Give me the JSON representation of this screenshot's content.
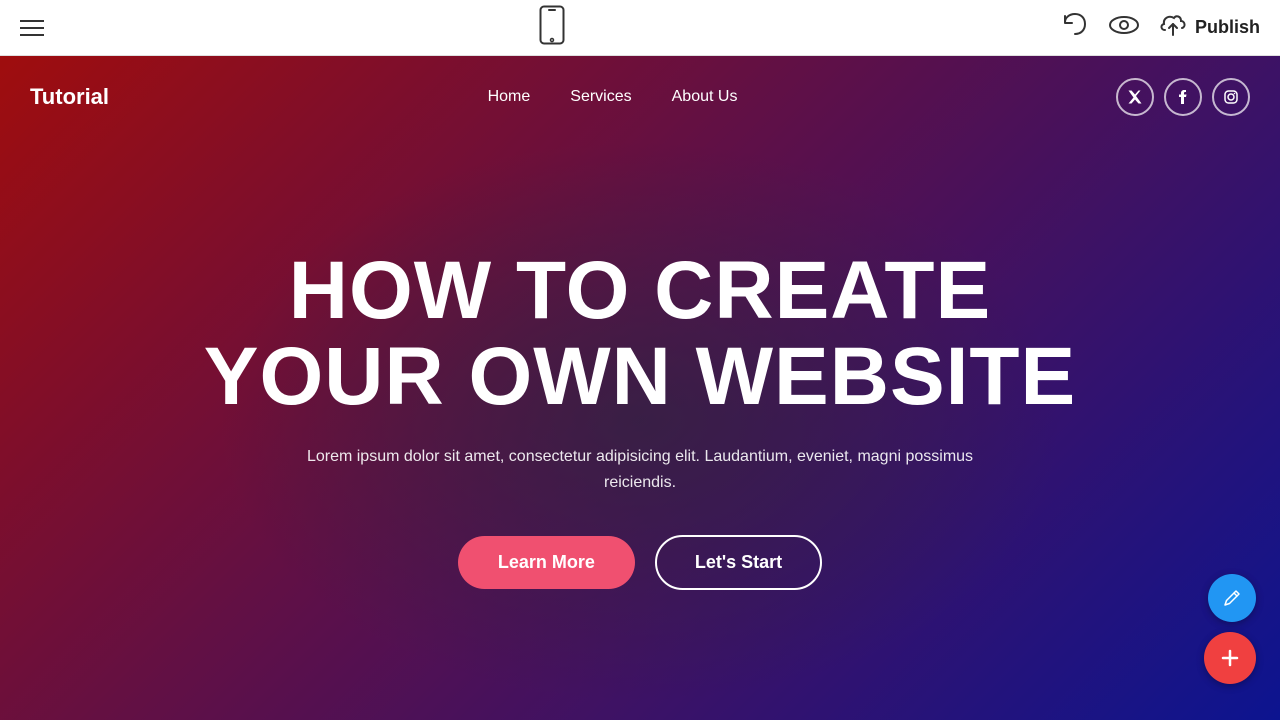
{
  "toolbar": {
    "publish_label": "Publish"
  },
  "site": {
    "logo": "Tutorial",
    "nav": {
      "links": [
        {
          "label": "Home"
        },
        {
          "label": "Services"
        },
        {
          "label": "About Us"
        }
      ]
    },
    "social": [
      {
        "name": "twitter",
        "icon": "𝕏"
      },
      {
        "name": "facebook",
        "icon": "f"
      },
      {
        "name": "instagram",
        "icon": "📷"
      }
    ],
    "hero": {
      "title_line1": "HOW TO CREATE",
      "title_line2": "YOUR OWN WEBSITE",
      "subtitle": "Lorem ipsum dolor sit amet, consectetur adipisicing elit. Laudantium, eveniet, magni possimus reiciendis.",
      "btn_learn_more": "Learn More",
      "btn_lets_start": "Let's Start"
    }
  }
}
